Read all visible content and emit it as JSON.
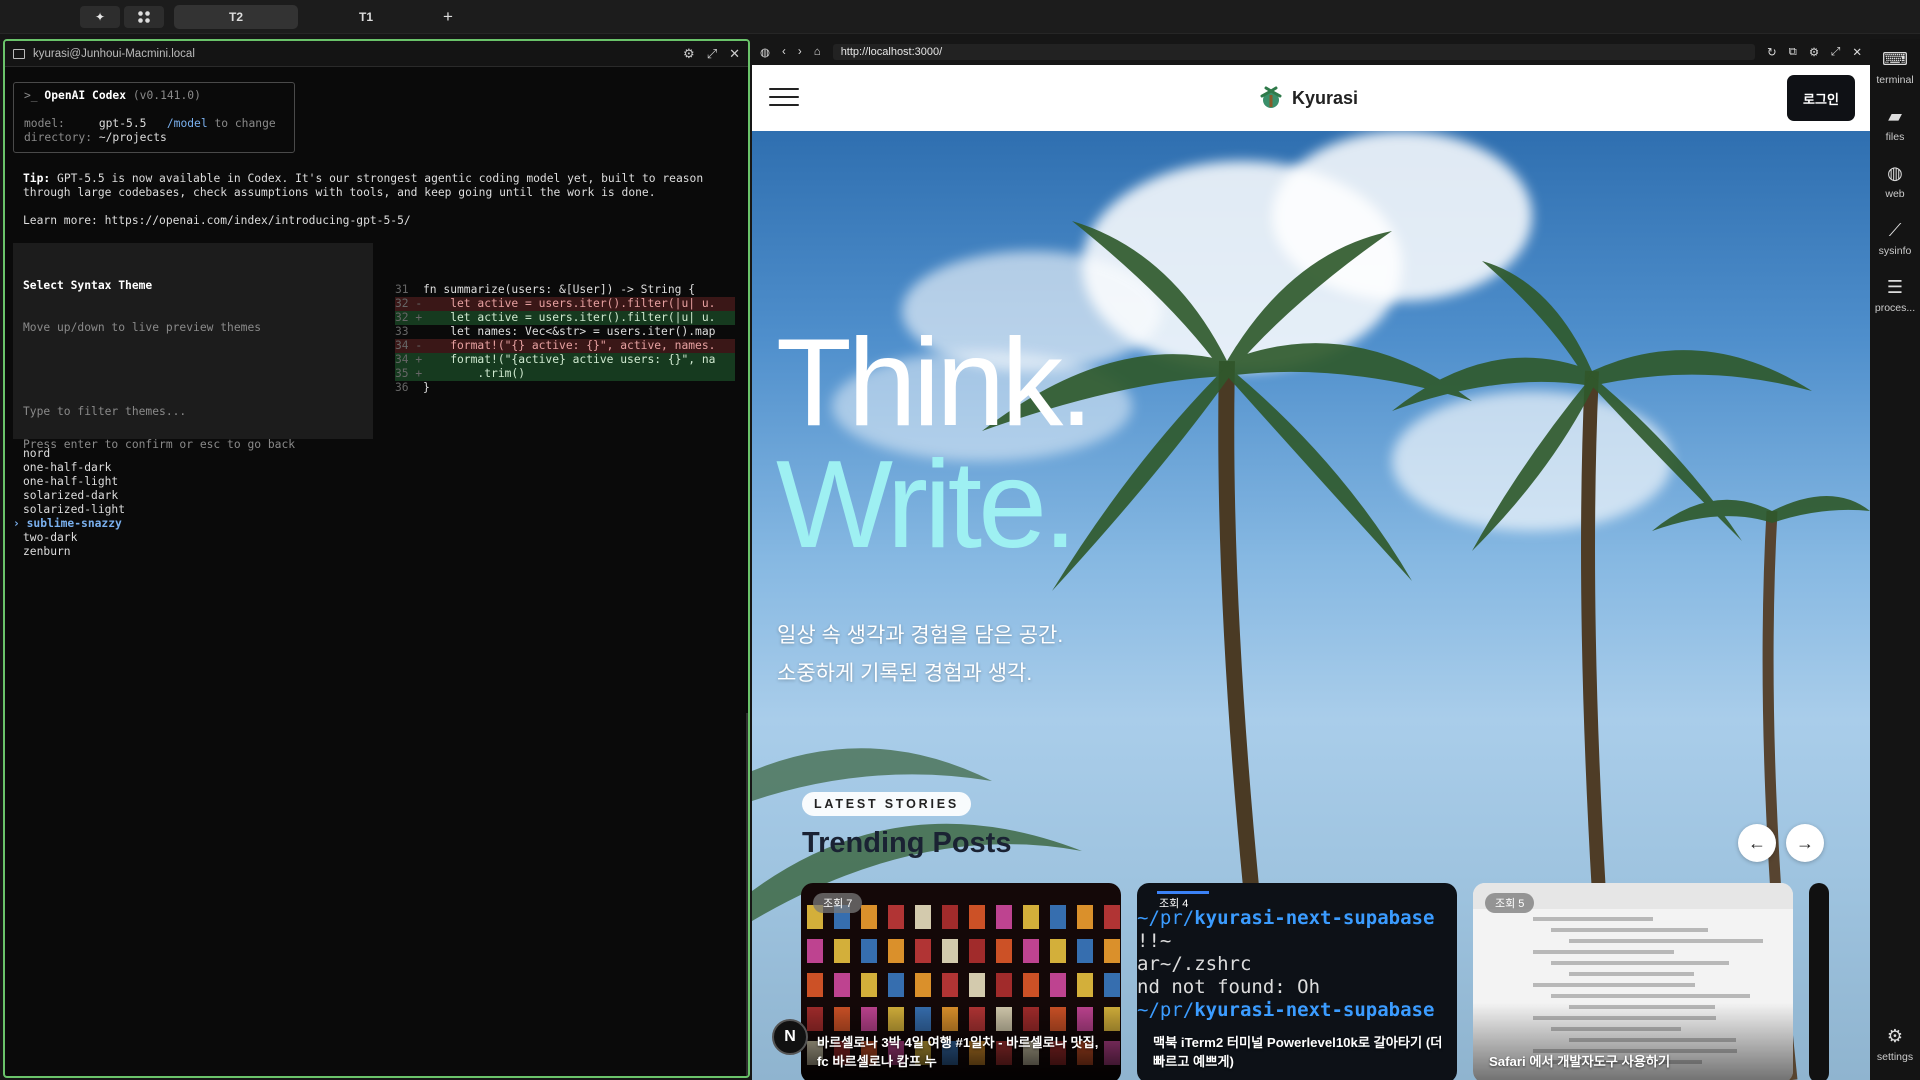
{
  "topbar": {
    "tabs": [
      {
        "label": "T2",
        "active": true
      },
      {
        "label": "T1",
        "active": false
      }
    ],
    "add_label": "+"
  },
  "terminal": {
    "title": "kyurasi@Junhoui-Macmini.local",
    "codex": {
      "prompt": ">_",
      "name": "OpenAI Codex",
      "version": "(v0.141.0)",
      "model_label": "model:",
      "model_value": "gpt-5.5",
      "model_cmd": "/model",
      "model_hint": "to change",
      "dir_label": "directory:",
      "dir_value": "~/projects"
    },
    "tip_label": "Tip:",
    "tip_text1": "GPT-5.5 is now available in Codex. It's our strongest agentic coding model yet, built to reason",
    "tip_text2": "through large codebases, check assumptions with tools, and keep going until the work is done.",
    "learn_more": "Learn more: https://openai.com/index/introducing-gpt-5-5/",
    "picker": {
      "title": "Select Syntax Theme",
      "hint": "Move up/down to live preview themes",
      "filter_placeholder": "Type to filter themes...",
      "themes": [
        "nord",
        "one-half-dark",
        "one-half-light",
        "solarized-dark",
        "solarized-light",
        "sublime-snazzy",
        "two-dark",
        "zenburn"
      ],
      "selected_marker": "›"
    },
    "preview": [
      {
        "ln": "31",
        "sign": " ",
        "code": "fn summarize(users: &[User]) -> String {",
        "kind": "ctx"
      },
      {
        "ln": "32",
        "sign": "-",
        "code": "    let active = users.iter().filter(|u| u.",
        "kind": "del"
      },
      {
        "ln": "32",
        "sign": "+",
        "code": "    let active = users.iter().filter(|u| u.",
        "kind": "add"
      },
      {
        "ln": "33",
        "sign": " ",
        "code": "    let names: Vec<&str> = users.iter().map",
        "kind": "ctx"
      },
      {
        "ln": "34",
        "sign": "-",
        "code": "    format!(\"{} active: {}\", active, names.",
        "kind": "del"
      },
      {
        "ln": "34",
        "sign": "+",
        "code": "    format!(\"{active} active users: {}\", na",
        "kind": "add"
      },
      {
        "ln": "35",
        "sign": "+",
        "code": "        .trim()",
        "kind": "add"
      },
      {
        "ln": "36",
        "sign": " ",
        "code": "}",
        "kind": "ctx"
      }
    ],
    "footer": "Press enter to confirm or esc to go back"
  },
  "browser": {
    "url": "http://localhost:3000/",
    "site": {
      "brand": "Kyurasi",
      "login": "로그인",
      "hero_line1": "Think.",
      "hero_line2": "Write.",
      "sub1": "일상 속 생각과 경험을 담은 공간.",
      "sub2": "소중하게 기록된 경험과 생각.",
      "badge": "LATEST STORIES",
      "section_title": "Trending Posts",
      "prev": "←",
      "next": "→",
      "n_badge": "N",
      "cards": [
        {
          "views": "조회 7",
          "title": "바르셀로나 3박 4일 여행 #1일차 - 바르셀로나 맛집, fc 바르셀로나 캄프 누"
        },
        {
          "views": "조회 4",
          "title": "맥북 iTerm2 터미널 Powerlevel10k로 갈아타기 (더 빠르고 예쁘게)"
        },
        {
          "views": "조회 5",
          "title": "Safari 에서 개발자도구 사용하기"
        }
      ],
      "card2_lines": [
        "~/pr/kyurasi-next-supabase",
        "!!~",
        "ar~/.zshrc",
        "nd not found: Oh",
        "~/pr/kyurasi-next-supabase"
      ]
    }
  },
  "rail": {
    "items": [
      {
        "label": "terminal",
        "icon": "terminal-icon"
      },
      {
        "label": "files",
        "icon": "folder-icon"
      },
      {
        "label": "web",
        "icon": "globe-icon"
      },
      {
        "label": "sysinfo",
        "icon": "chart-icon"
      },
      {
        "label": "proces...",
        "icon": "process-icon"
      }
    ],
    "settings": "settings"
  },
  "colors": {
    "accent_green": "#6ac36a",
    "hero_cyan": "#9ef0f2",
    "selected_theme": "#7ab0ee"
  }
}
